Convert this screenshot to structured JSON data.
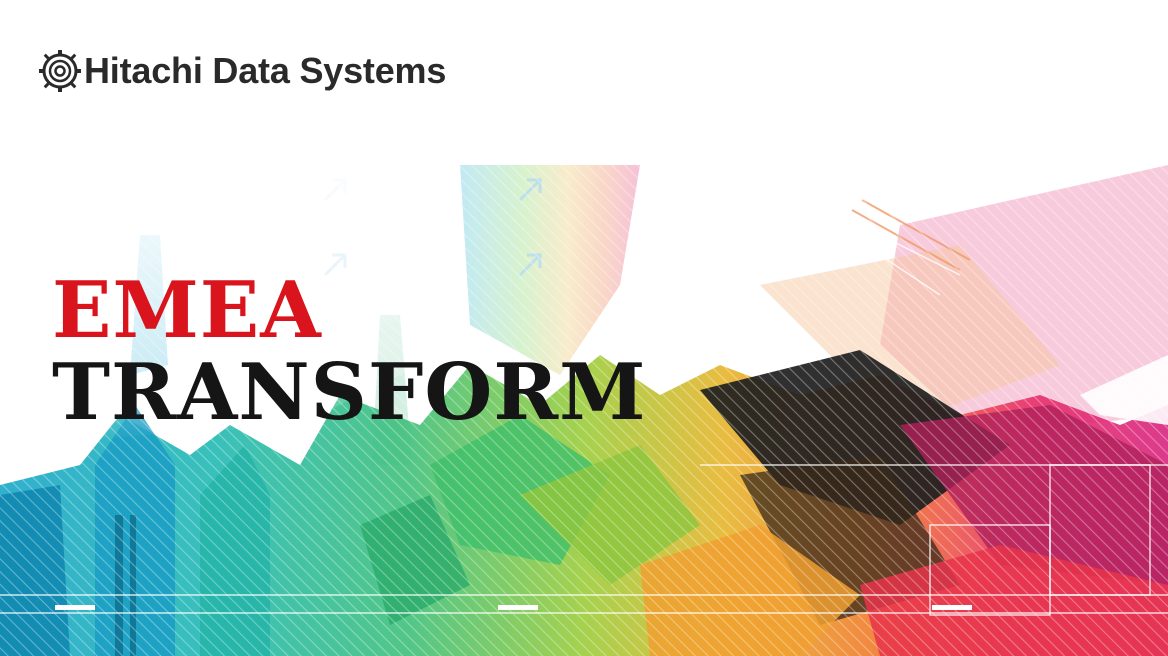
{
  "header": {
    "logo_icon": "hitachi-logo-icon",
    "brand_name": "Hitachi Data Systems"
  },
  "hero": {
    "headline_line1": "EMEA",
    "headline_line2": "TRANSFORM",
    "colors": {
      "accent_red": "#d9141c",
      "text_dark": "#151515"
    },
    "art_icon": "abstract-city-skyline-graphic"
  }
}
